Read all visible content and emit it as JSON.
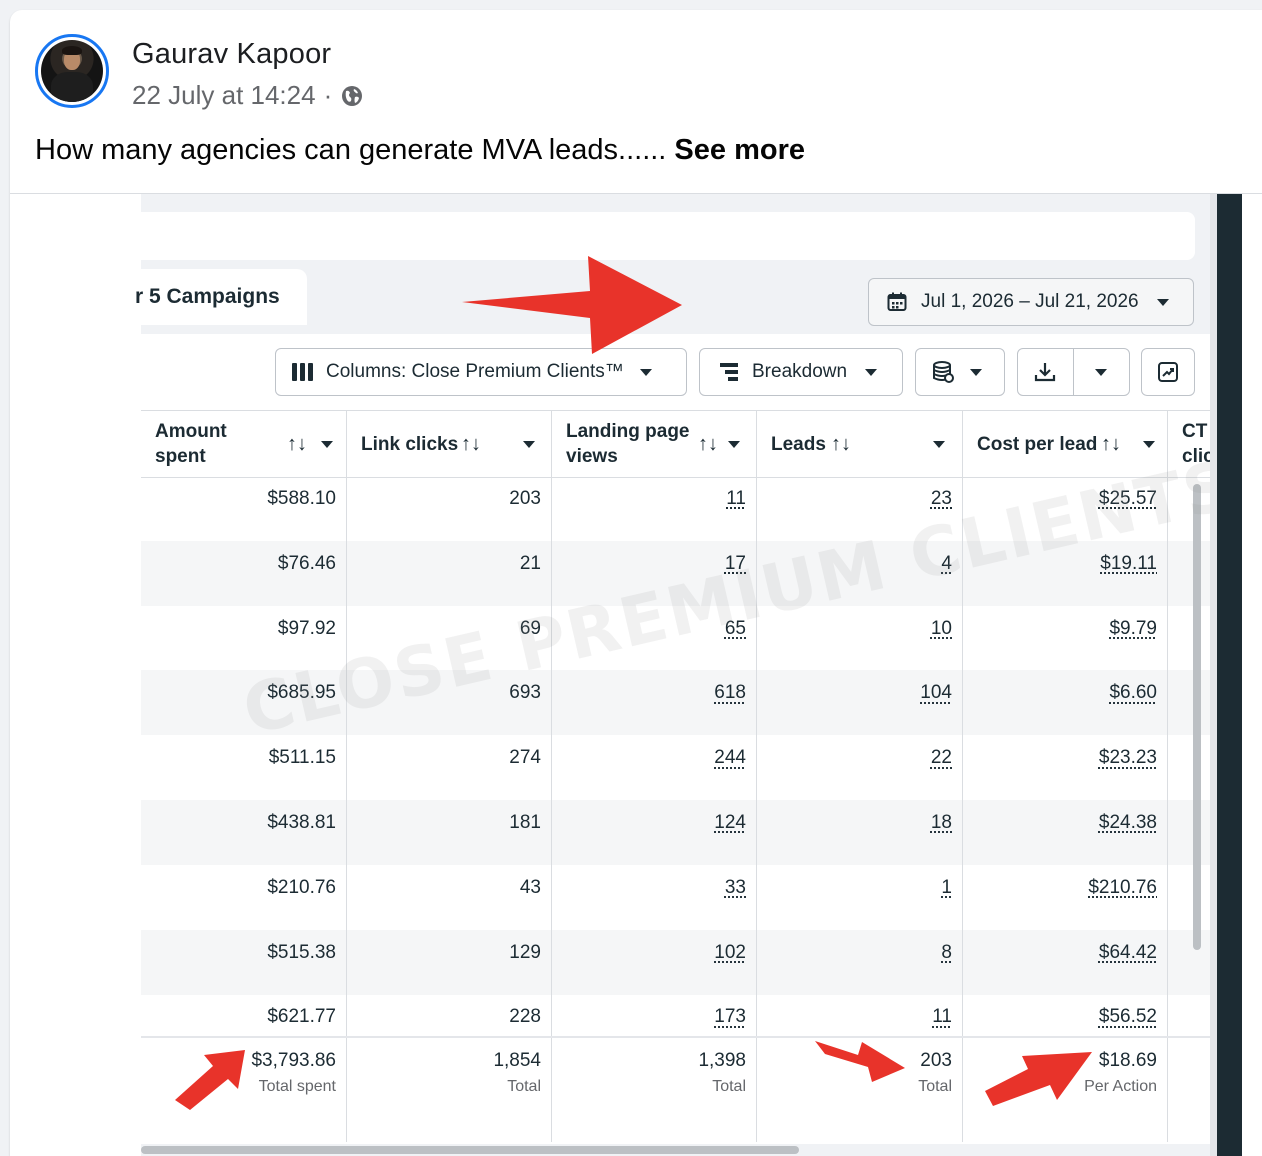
{
  "post": {
    "author": "Gaurav Kapoor",
    "timestamp": "22 July at 14:24",
    "separator": "·",
    "privacy_icon": "globe-icon",
    "text": "How many agencies can generate MVA leads......",
    "see_more": "See more"
  },
  "ads_manager": {
    "tab_label": "r 5 Campaigns",
    "date_range": "Jul 1, 2026 – Jul 21, 2026",
    "toolbar": {
      "columns_label": "Columns: Close Premium Clients™",
      "breakdown_label": "Breakdown"
    },
    "watermark": "CLOSE PREMIUM CLIENTS",
    "columns": [
      {
        "line1": "Amount",
        "line2": "spent"
      },
      {
        "line1": "Link clicks",
        "line2": ""
      },
      {
        "line1": "Landing page",
        "line2": "views"
      },
      {
        "line1": "Leads",
        "line2": ""
      },
      {
        "line1": "Cost per lead",
        "line2": ""
      },
      {
        "line1": "CT",
        "line2": "clic"
      }
    ],
    "sort_glyph": "↑↓",
    "rows": [
      {
        "amount": "$588.10",
        "link_clicks": "203",
        "lpv": "11",
        "leads": "23",
        "cpl": "$25.57"
      },
      {
        "amount": "$76.46",
        "link_clicks": "21",
        "lpv": "17",
        "leads": "4",
        "cpl": "$19.11"
      },
      {
        "amount": "$97.92",
        "link_clicks": "69",
        "lpv": "65",
        "leads": "10",
        "cpl": "$9.79"
      },
      {
        "amount": "$685.95",
        "link_clicks": "693",
        "lpv": "618",
        "leads": "104",
        "cpl": "$6.60"
      },
      {
        "amount": "$511.15",
        "link_clicks": "274",
        "lpv": "244",
        "leads": "22",
        "cpl": "$23.23"
      },
      {
        "amount": "$438.81",
        "link_clicks": "181",
        "lpv": "124",
        "leads": "18",
        "cpl": "$24.38"
      },
      {
        "amount": "$210.76",
        "link_clicks": "43",
        "lpv": "33",
        "leads": "1",
        "cpl": "$210.76"
      },
      {
        "amount": "$515.38",
        "link_clicks": "129",
        "lpv": "102",
        "leads": "8",
        "cpl": "$64.42"
      },
      {
        "amount": "$621.77",
        "link_clicks": "228",
        "lpv": "173",
        "leads": "11",
        "cpl": "$56.52"
      }
    ],
    "totals": {
      "amount": {
        "value": "$3,793.86",
        "sub": "Total spent"
      },
      "link_clicks": {
        "value": "1,854",
        "sub": "Total"
      },
      "lpv": {
        "value": "1,398",
        "sub": "Total"
      },
      "leads": {
        "value": "203",
        "sub": "Total"
      },
      "cpl": {
        "value": "$18.69",
        "sub": "Per Action"
      }
    }
  },
  "colors": {
    "accent": "#1877f2",
    "arrow": "#e8332a",
    "text": "#1c2b33",
    "muted": "#65676b"
  }
}
